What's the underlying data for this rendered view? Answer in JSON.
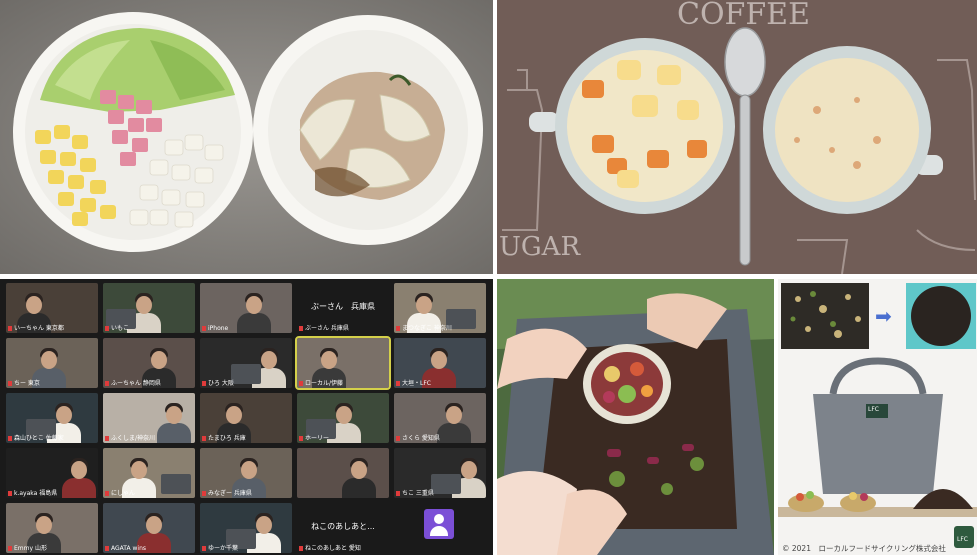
{
  "panels": {
    "top_left": {
      "label": "raw-vegetables-and-cooked-plate"
    },
    "top_right": {
      "label": "two-bowls-of-cream-stew",
      "mat_text_top": "COFFEE",
      "mat_text_side": "UGAR"
    },
    "bottom_left": {
      "tiles": [
        {
          "name": "いーちゃん 東京都"
        },
        {
          "name": "いもこ"
        },
        {
          "name": "iPhone"
        },
        {
          "name": "ぶーさん 兵庫県",
          "big": "ぶーさん　兵庫県"
        },
        {
          "name": "まつなぎこ 神奈川"
        },
        {
          "name": "ちー 東京"
        },
        {
          "name": "ふーちゃん 静岡県"
        },
        {
          "name": "ひろ 大阪"
        },
        {
          "name": "ローカル/伊藤"
        },
        {
          "name": "大垣・LFC"
        },
        {
          "name": "森山ひとこ 佐藤家"
        },
        {
          "name": "ふくしま/神奈川"
        },
        {
          "name": "たまひろ 兵庫"
        },
        {
          "name": "ホーリー"
        },
        {
          "name": "さくら 愛知県"
        },
        {
          "name": "k.ayaka 福島県"
        },
        {
          "name": "にしゃん"
        },
        {
          "name": "みなぎー 兵庫県"
        },
        {
          "name": ""
        },
        {
          "name": "ちこ 三重県"
        },
        {
          "name": "Emmy 山形"
        },
        {
          "name": "AGATA wins"
        },
        {
          "name": "ゆーか千葉"
        },
        {
          "name": "ねこのあしあと 愛知",
          "big": "ねこのあしあと..."
        },
        {
          "name": ""
        }
      ]
    },
    "bottom_middle": {
      "label": "compost-bag-with-food-scraps"
    },
    "bottom_right": {
      "arrow": "➡",
      "bag_tag": "LFC",
      "logo_text": "LFC",
      "copyright": "© 2021　ローカルフードサイクリング株式会社"
    }
  }
}
